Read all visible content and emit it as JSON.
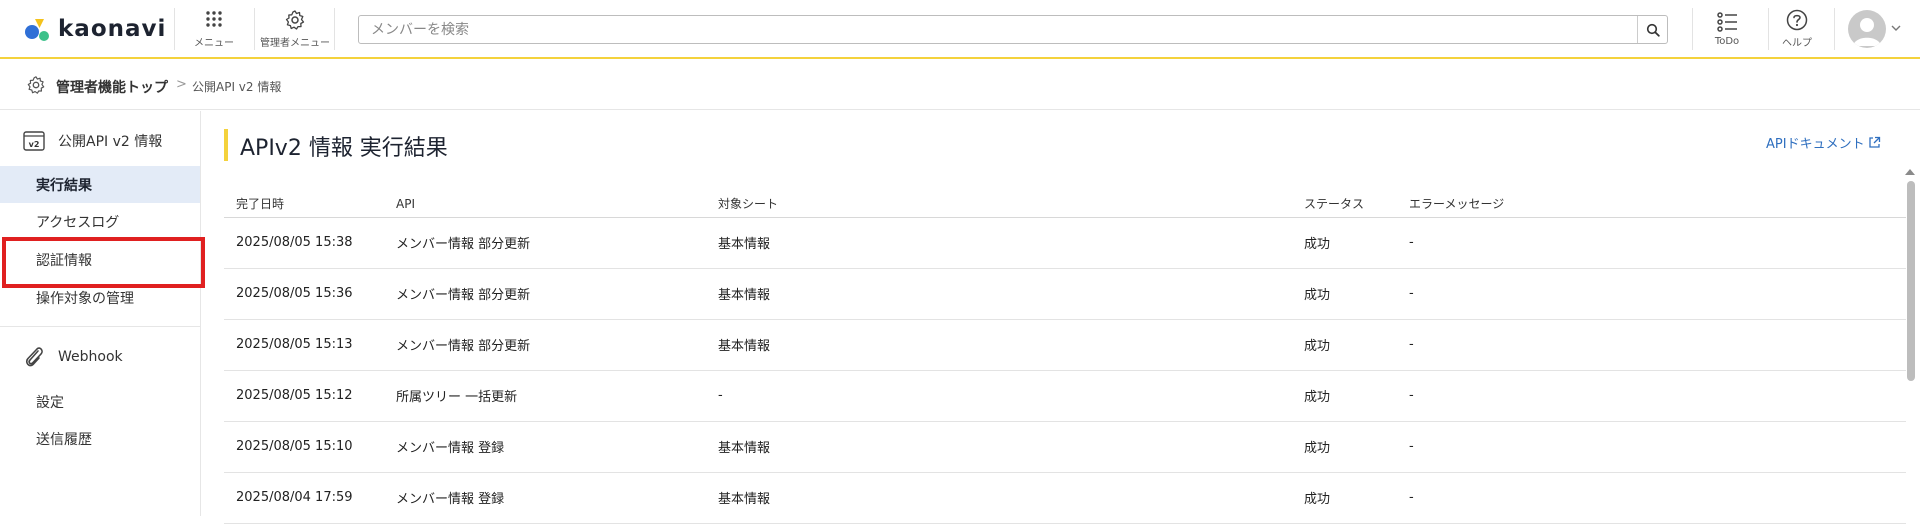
{
  "header": {
    "logo_text": "kaonavi",
    "menu_label": "メニュー",
    "admin_menu_label": "管理者メニュー",
    "search_placeholder": "メンバーを検索",
    "todo_label": "ToDo",
    "help_label": "ヘルプ"
  },
  "breadcrumb": {
    "root": "管理者機能トップ",
    "separator": ">",
    "current": "公開API v2 情報"
  },
  "sidebar": {
    "section1_title": "公開API v2 情報",
    "section1_icon_text": "v2",
    "items1": [
      "実行結果",
      "アクセスログ",
      "認証情報",
      "操作対象の管理"
    ],
    "section2_title": "Webhook",
    "items2": [
      "設定",
      "送信履歴"
    ]
  },
  "main": {
    "title": "APIv2 情報 実行結果",
    "doc_link": "APIドキュメント",
    "columns": [
      "完了日時",
      "API",
      "対象シート",
      "ステータス",
      "エラーメッセージ"
    ],
    "rows": [
      [
        "2025/08/05 15:38",
        "メンバー情報 部分更新",
        "基本情報",
        "成功",
        "-"
      ],
      [
        "2025/08/05 15:36",
        "メンバー情報 部分更新",
        "基本情報",
        "成功",
        "-"
      ],
      [
        "2025/08/05 15:13",
        "メンバー情報 部分更新",
        "基本情報",
        "成功",
        "-"
      ],
      [
        "2025/08/05 15:12",
        "所属ツリー 一括更新",
        "-",
        "成功",
        "-"
      ],
      [
        "2025/08/05 15:10",
        "メンバー情報 登録",
        "基本情報",
        "成功",
        "-"
      ],
      [
        "2025/08/04 17:59",
        "メンバー情報 登録",
        "基本情報",
        "成功",
        "-"
      ]
    ]
  },
  "colors": {
    "accent_yellow": "#f4d23c",
    "link_blue": "#2f6fbf",
    "highlight_red": "#e02020",
    "active_bg": "#e3ebf7"
  }
}
